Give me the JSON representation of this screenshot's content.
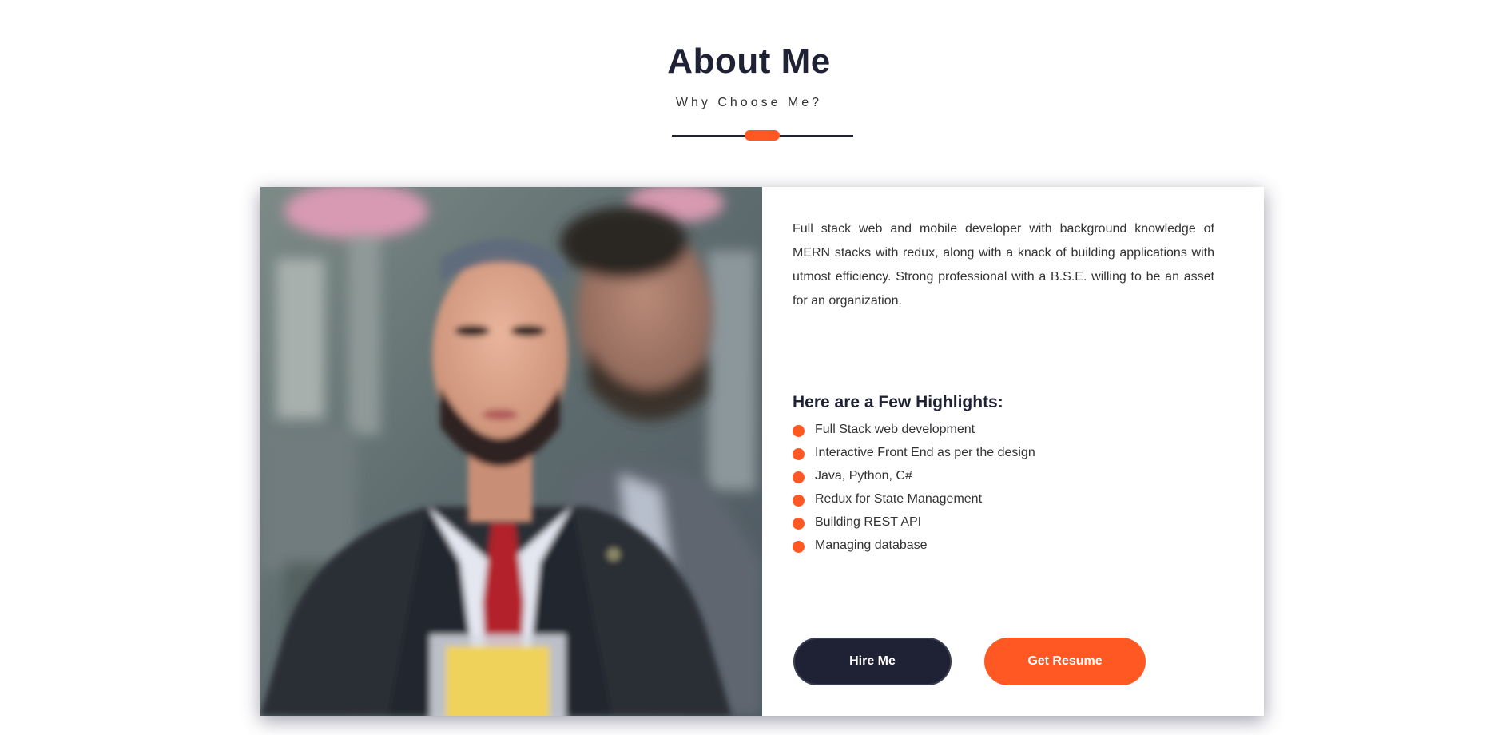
{
  "section": {
    "title": "About Me",
    "subtitle": "Why Choose Me?"
  },
  "about": {
    "bio": "Full stack web and mobile developer with background knowledge of MERN stacks with redux, along with a knack of building applications with utmost efficiency. Strong professional with a B.S.E. willing to be an asset for an organization.",
    "highlights_title": "Here are a Few Highlights:",
    "highlights": [
      "Full Stack web development",
      "Interactive Front End as per the design",
      "Java, Python, C#",
      "Redux for State Management",
      "Building REST API",
      "Managing database"
    ]
  },
  "buttons": {
    "hire_label": "Hire Me",
    "resume_label": "Get Resume"
  },
  "colors": {
    "accent": "#ff5823",
    "dark": "#1f2235",
    "text": "#333333"
  }
}
